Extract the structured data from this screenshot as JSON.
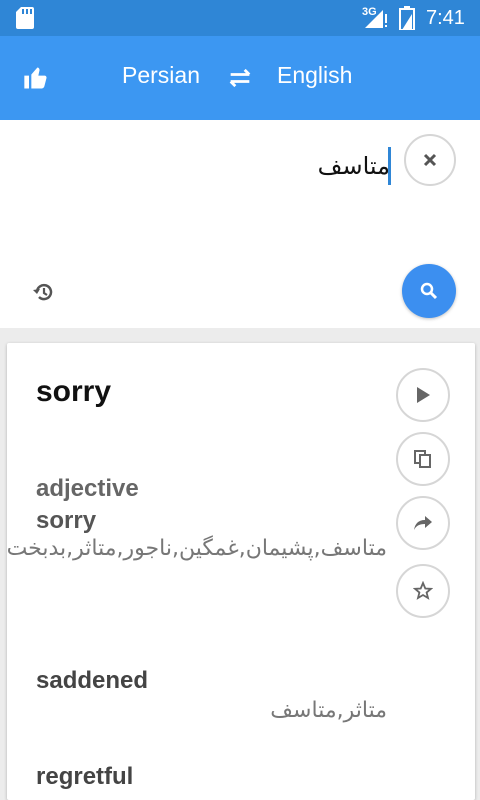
{
  "status_bar": {
    "network": "3G",
    "time": "7:41",
    "icons": [
      "sd-card-icon",
      "signal-icon",
      "battery-icon"
    ]
  },
  "toolbar": {
    "source_language": "Persian",
    "target_language": "English",
    "icons": [
      "thumbs-up-icon",
      "swap-icon"
    ]
  },
  "input": {
    "text": "متاسف"
  },
  "result": {
    "headword": "sorry",
    "part_of_speech": "adjective",
    "entries": [
      {
        "word": "sorry",
        "translation": "متاسف,پشیمان,غمگین,ناجور,متاثر,بدبخت"
      },
      {
        "word": "saddened",
        "translation": "متاثر,متاسف"
      },
      {
        "word": "regretful",
        "translation": ""
      }
    ],
    "actions": [
      "play-icon",
      "copy-icon",
      "share-icon",
      "star-icon"
    ]
  },
  "colors": {
    "status_bar": "#2f86d6",
    "toolbar": "#3c97f2",
    "search_button": "#3c8ff0"
  }
}
